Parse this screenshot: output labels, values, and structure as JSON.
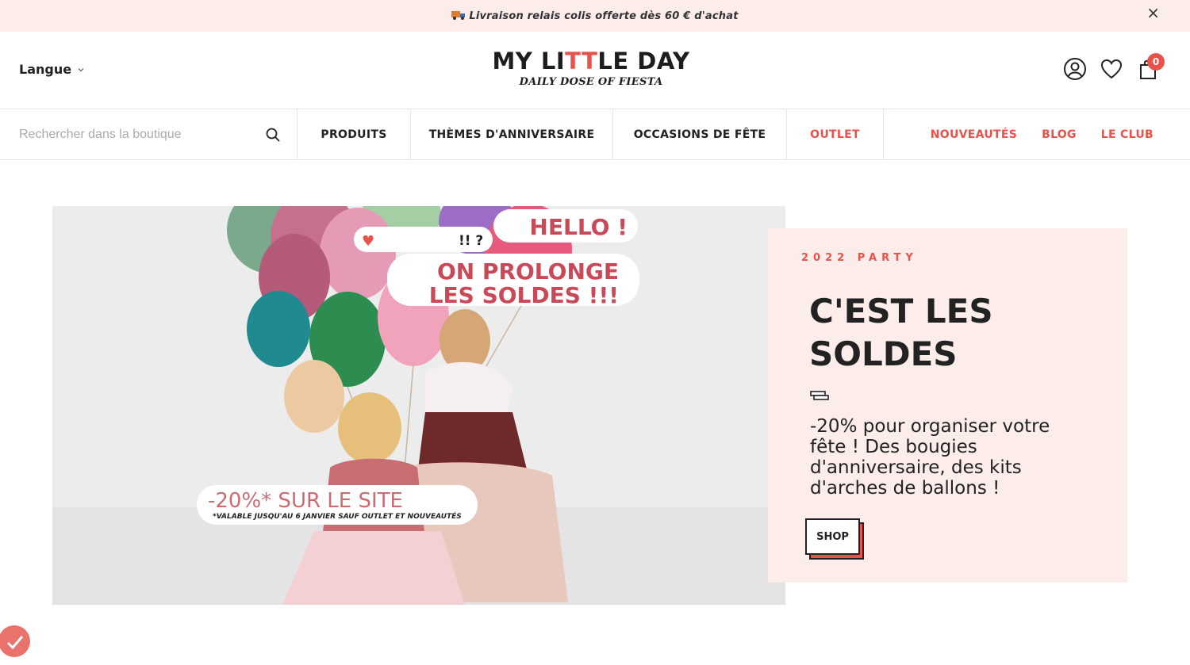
{
  "announcement": {
    "text": "Livraison relais colis offerte dès 60 € d'achat",
    "icon": "truck-icon",
    "close_label": "×"
  },
  "header": {
    "language_label": "Langue",
    "logo_main_a": "MY LI",
    "logo_main_tt": "TT",
    "logo_main_b": "LE DAY",
    "logo_sub": "DAILY DOSE OF FIESTA",
    "cart_count": "0",
    "icons": [
      "user-icon",
      "heart-icon",
      "bag-icon"
    ]
  },
  "nav": {
    "search_placeholder": "Rechercher dans la boutique",
    "items": [
      {
        "label": "PRODUITS"
      },
      {
        "label": "THÈMES D'ANNIVERSAIRE"
      },
      {
        "label": "OCCASIONS DE FÊTE"
      },
      {
        "label": "OUTLET"
      }
    ],
    "right_links": [
      {
        "label": "NOUVEAUTÉS"
      },
      {
        "label": "BLOG"
      },
      {
        "label": "LE CLUB"
      }
    ]
  },
  "hero": {
    "image_texts": {
      "bubble_hello": "HELLO !",
      "bubble_prolonge_1": "ON PROLONGE",
      "bubble_prolonge_2": "LES SOLDES !!!",
      "reactions": "!! ?",
      "promo": "-20%* SUR LE SITE",
      "promo_note": "*VALABLE JUSQU'AU 6 JANVIER SAUF OUTLET ET NOUVEAUTÉS"
    },
    "eyebrow": "2022 PARTY",
    "title": "C'EST LES SOLDES",
    "description": "-20% pour organiser votre fête ! Des bougies d'anniversaire, des kits d'arches de ballons !",
    "shop_label": "SHOP"
  },
  "colors": {
    "accent": "#e9524a",
    "pink_bg": "#fcecea",
    "text": "#222222"
  }
}
